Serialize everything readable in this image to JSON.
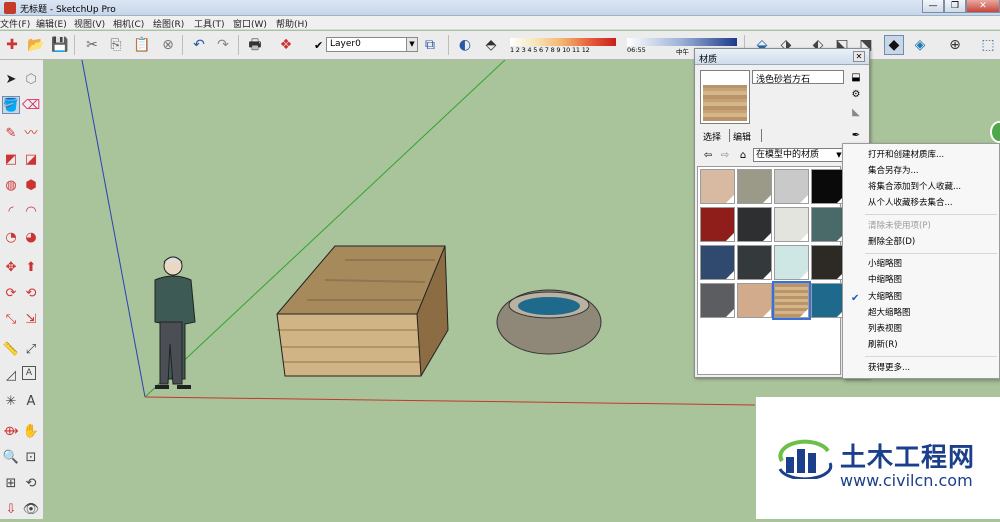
{
  "titlebar": {
    "title": "无标题 - SketchUp Pro",
    "buttons": [
      "—",
      "❐",
      "✕"
    ]
  },
  "menu": [
    "文件(F)",
    "编辑(E)",
    "视图(V)",
    "相机(C)",
    "绘图(R)",
    "工具(T)",
    "窗口(W)",
    "帮助(H)"
  ],
  "toolbar": {
    "layer_name": "Layer0",
    "shadow_ticks": "1 2 3 4 5 6 7 8 9 10 11 12",
    "time_start": "06:55",
    "time_mid": "中午"
  },
  "materials_panel": {
    "title": "材质",
    "close": "✕",
    "material_name": "浅色砂岩方石",
    "tabs": [
      "选择",
      "编辑"
    ],
    "collection": "在模型中的材质",
    "swatch_colors": [
      "#d8b9a2",
      "#9b9a88",
      "#c9c9c9",
      "#0a0a0a",
      "#8f1d1a",
      "#2d2f31",
      "#e4e4de",
      "#496a68",
      "#2f4a6e",
      "#34393c",
      "#cfe7e4",
      "#2d2925",
      "#5b5d60",
      "#d2ab8d",
      "#c9a67b",
      "#1f6a8c"
    ]
  },
  "context_menu": {
    "items": [
      {
        "label": "打开和创建材质库...",
        "disabled": false
      },
      {
        "label": "集合另存为...",
        "disabled": false
      },
      {
        "label": "将集合添加到个人收藏...",
        "disabled": false
      },
      {
        "label": "从个人收藏移去集合...",
        "disabled": false
      },
      {
        "label": "清除未使用项(P)",
        "disabled": true
      },
      {
        "label": "删除全部(D)",
        "disabled": false
      },
      {
        "label": "小缩略图",
        "disabled": false
      },
      {
        "label": "中缩略图",
        "disabled": false
      },
      {
        "label": "大缩略图",
        "disabled": false,
        "checked": true
      },
      {
        "label": "超大缩略图",
        "disabled": false
      },
      {
        "label": "列表视图",
        "disabled": false
      },
      {
        "label": "刷新(R)",
        "disabled": false
      },
      {
        "label": "获得更多...",
        "disabled": false
      }
    ]
  },
  "watermark": {
    "title": "土木工程网",
    "url": "www.civilcn.com"
  },
  "colors": {
    "viewport_bg": "#a9c39b",
    "axis_red": "#c23a2a",
    "axis_green": "#2fa52f",
    "axis_blue": "#2a3fb8",
    "watermark_blue": "#1c3f8c"
  }
}
